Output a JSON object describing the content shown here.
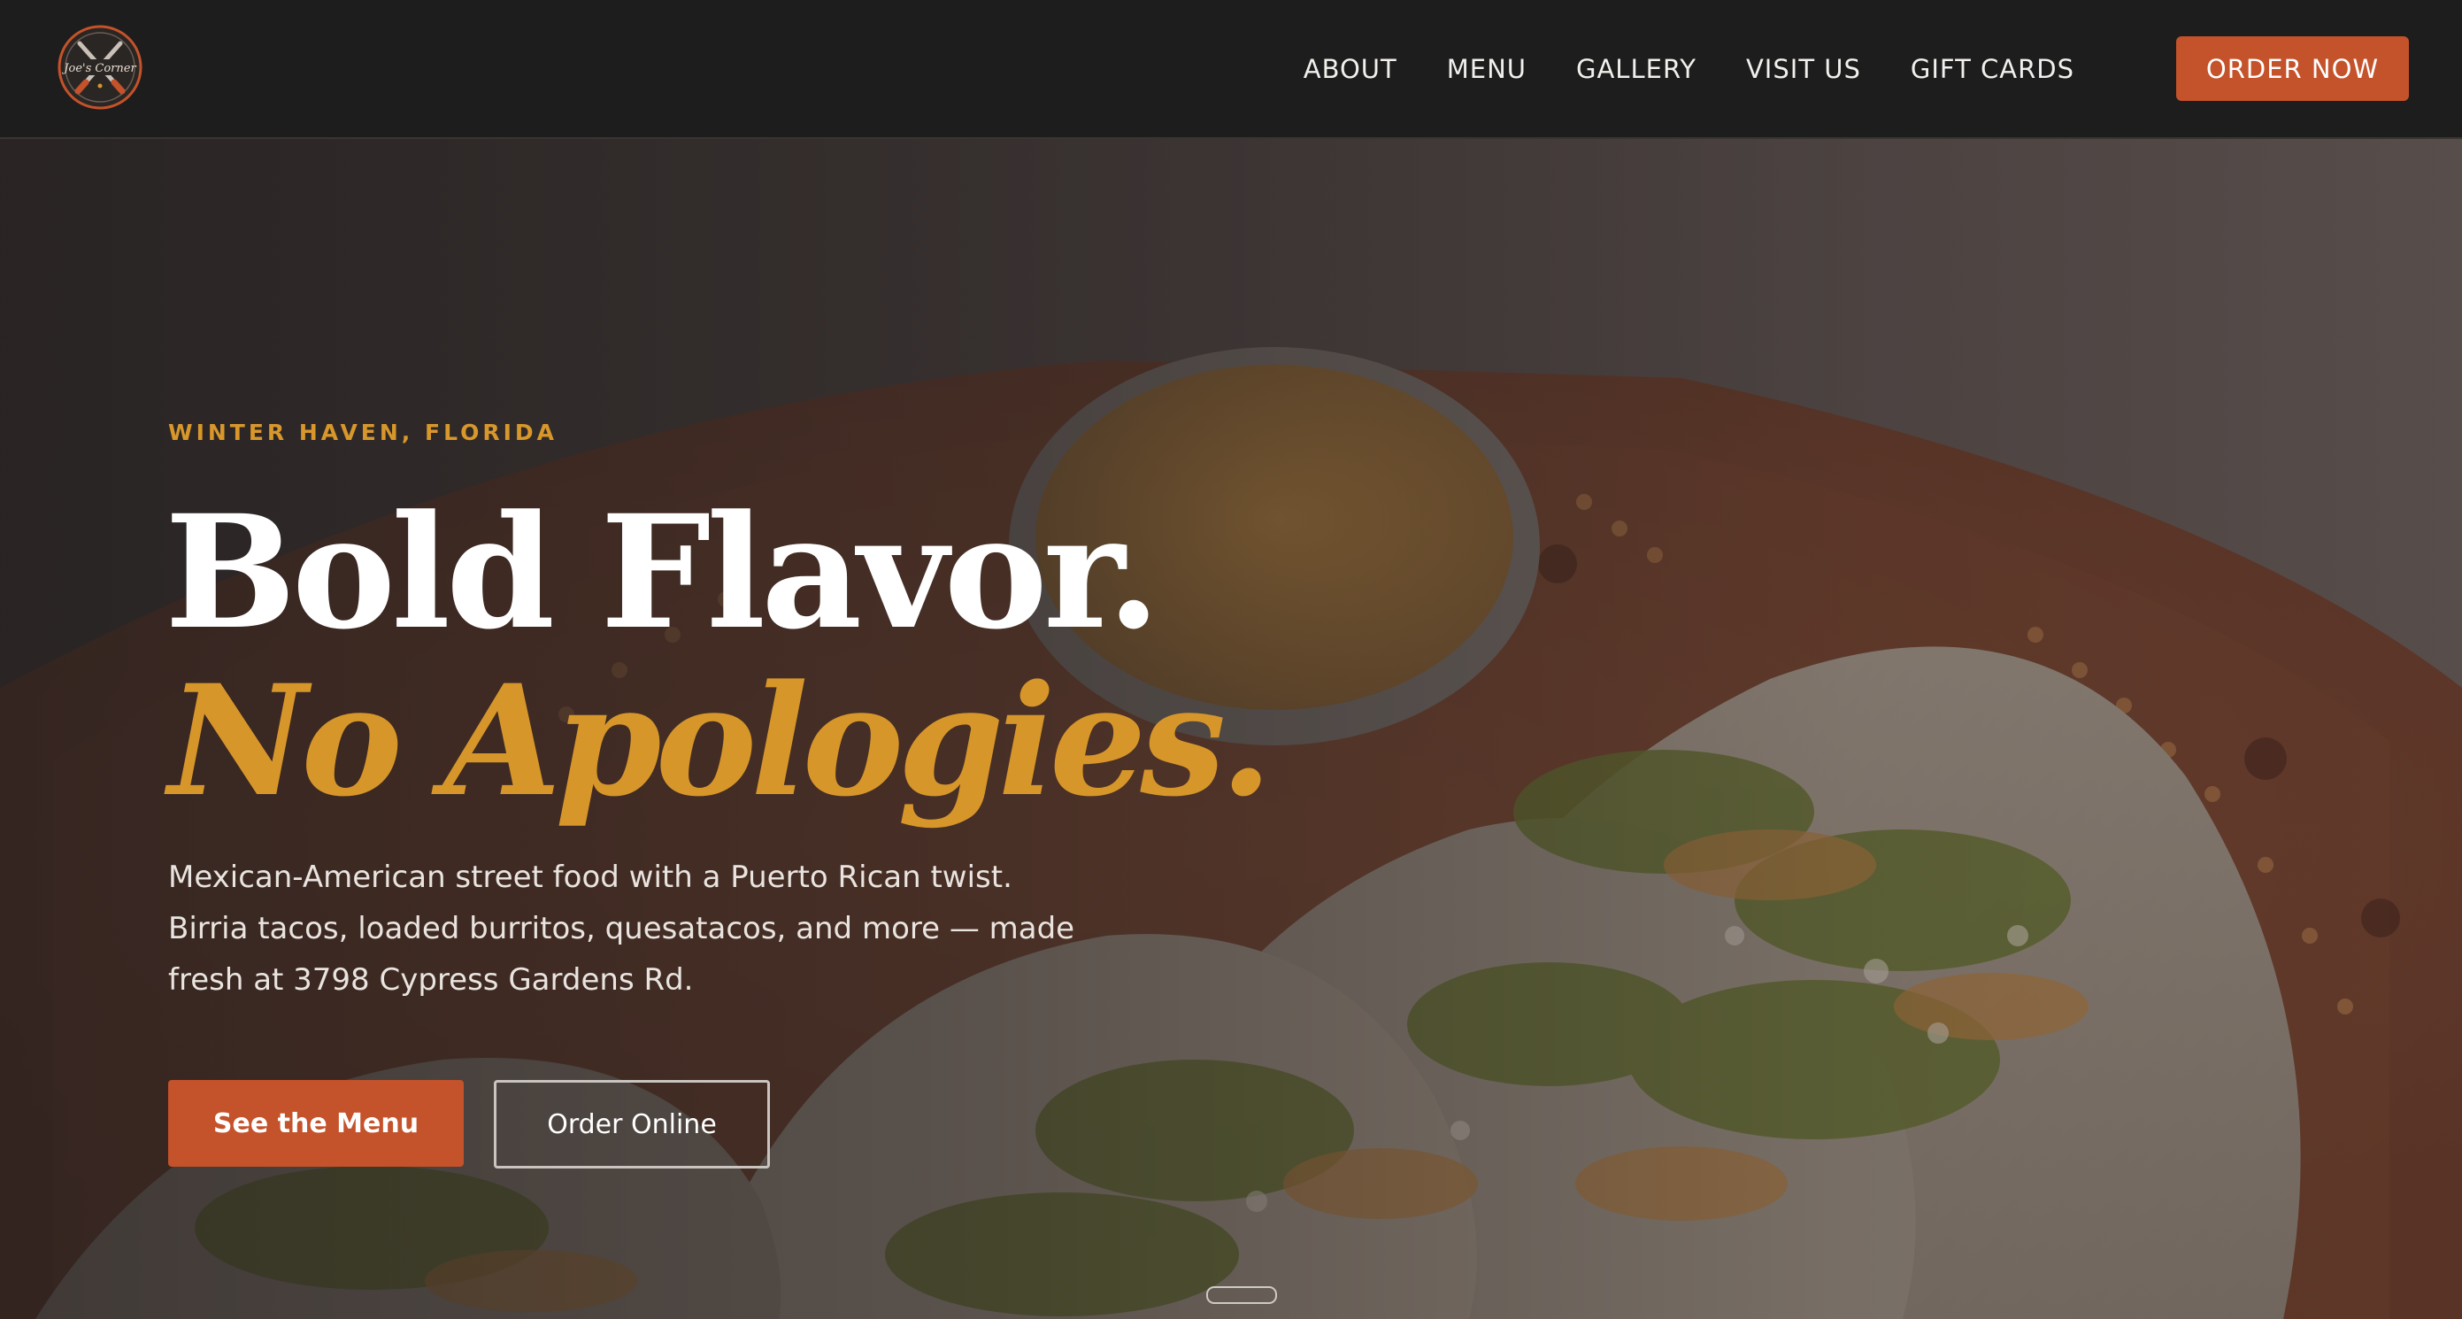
{
  "nav": {
    "logo_text": "Joe's Corner",
    "links": [
      "ABOUT",
      "MENU",
      "GALLERY",
      "VISIT US",
      "GIFT CARDS"
    ],
    "cta": "ORDER NOW"
  },
  "hero": {
    "location": "WINTER HAVEN, FLORIDA",
    "headline_line1": "Bold Flavor.",
    "headline_line2": "No Apologies.",
    "description": "Mexican-American street food with a Puerto Rican twist. Birria tacos, loaded burritos, quesatacos, and more — made fresh at 3798 Cypress Gardens Rd.",
    "primary_button": "See the Menu",
    "secondary_button": "Order Online",
    "image": "tacos-platter-photo"
  },
  "colors": {
    "accent": "#c4522a",
    "gold": "#d7962a",
    "nav_bg": "#1d1d1d"
  }
}
